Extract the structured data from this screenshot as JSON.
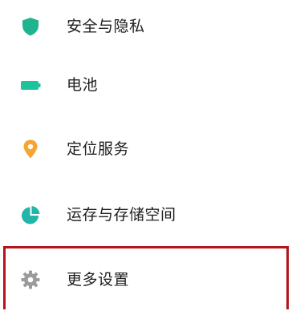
{
  "settings": {
    "items": [
      {
        "label": "安全与隐私",
        "icon": "shield-icon",
        "color": "#1fb48f"
      },
      {
        "label": "电池",
        "icon": "battery-icon",
        "color": "#1dc39a"
      },
      {
        "label": "定位服务",
        "icon": "location-pin-icon",
        "color": "#f4a533"
      },
      {
        "label": "运存与存储空间",
        "icon": "storage-pie-icon",
        "color": "#22b5a8"
      },
      {
        "label": "更多设置",
        "icon": "gear-icon",
        "color": "#9b9b9b"
      }
    ],
    "highlight_color": "#b3151b"
  }
}
